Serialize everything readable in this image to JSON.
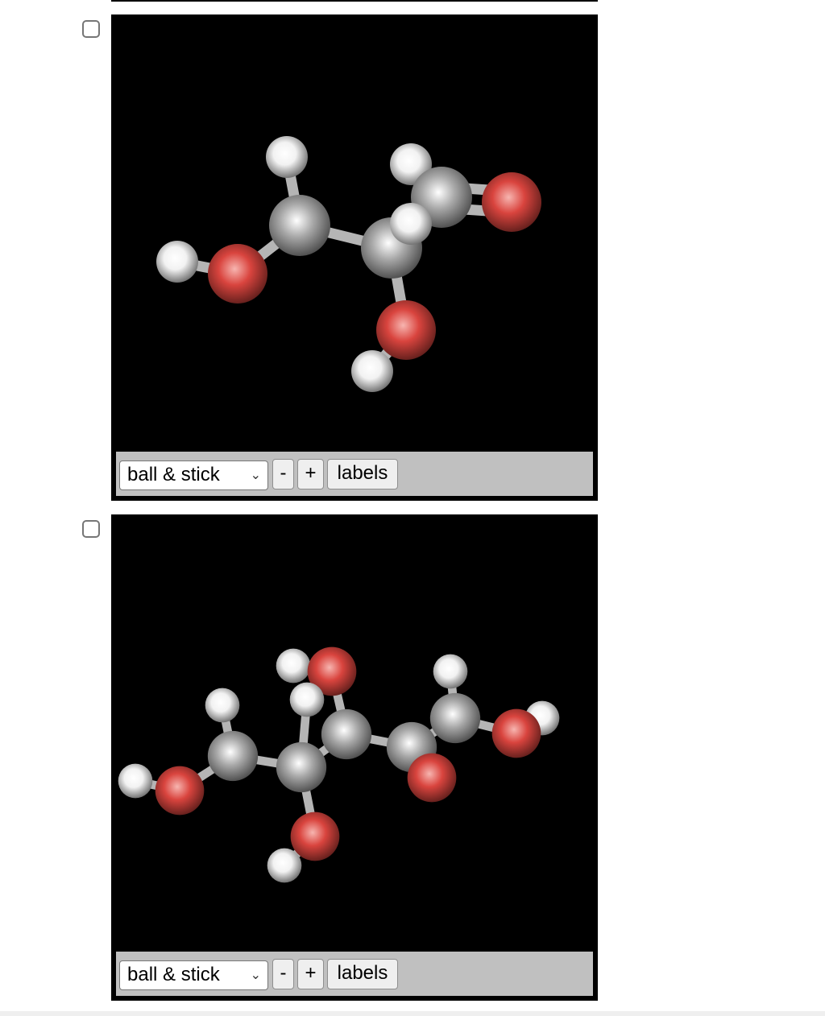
{
  "questions": [
    {
      "checkbox": {
        "checked": false
      },
      "viewer": {
        "style_select": {
          "selected": "ball & stick",
          "icon": "chevron-down-icon"
        },
        "zoom_out_label": "-",
        "zoom_in_label": "+",
        "labels_button": "labels",
        "molecule": {
          "atoms": [
            "H",
            "C",
            "H",
            "O",
            "C",
            "H",
            "C",
            "H",
            "O",
            "O",
            "H"
          ],
          "bonds": [
            [
              0,
              1
            ],
            [
              1,
              3
            ],
            [
              2,
              3
            ],
            [
              1,
              4
            ],
            [
              4,
              5
            ],
            [
              4,
              6
            ],
            [
              6,
              7
            ],
            [
              6,
              9
            ],
            [
              4,
              8
            ],
            [
              8,
              10
            ]
          ],
          "double_bonds": [
            [
              6,
              9
            ]
          ]
        }
      }
    },
    {
      "checkbox": {
        "checked": false
      },
      "viewer": {
        "style_select": {
          "selected": "ball & stick",
          "icon": "chevron-down-icon"
        },
        "zoom_out_label": "-",
        "zoom_in_label": "+",
        "labels_button": "labels",
        "molecule": {
          "atoms": [
            "H",
            "O",
            "C",
            "H",
            "C",
            "H",
            "O",
            "H",
            "C",
            "O",
            "H",
            "C",
            "O",
            "C",
            "H",
            "O",
            "H"
          ],
          "bonds": [
            [
              0,
              1
            ],
            [
              1,
              2
            ],
            [
              2,
              3
            ],
            [
              2,
              4
            ],
            [
              4,
              5
            ],
            [
              4,
              6
            ],
            [
              6,
              7
            ],
            [
              4,
              8
            ],
            [
              8,
              9
            ],
            [
              9,
              10
            ],
            [
              8,
              11
            ],
            [
              11,
              12
            ],
            [
              11,
              13
            ],
            [
              13,
              14
            ],
            [
              13,
              15
            ],
            [
              15,
              16
            ]
          ],
          "double_bonds": [
            [
              11,
              12
            ]
          ]
        }
      }
    }
  ],
  "colors": {
    "carbon": "#a8a8a8",
    "oxygen": "#d9443e",
    "hydrogen": "#f2f2f2",
    "bond": "#b5b5b5",
    "background": "#000000"
  }
}
